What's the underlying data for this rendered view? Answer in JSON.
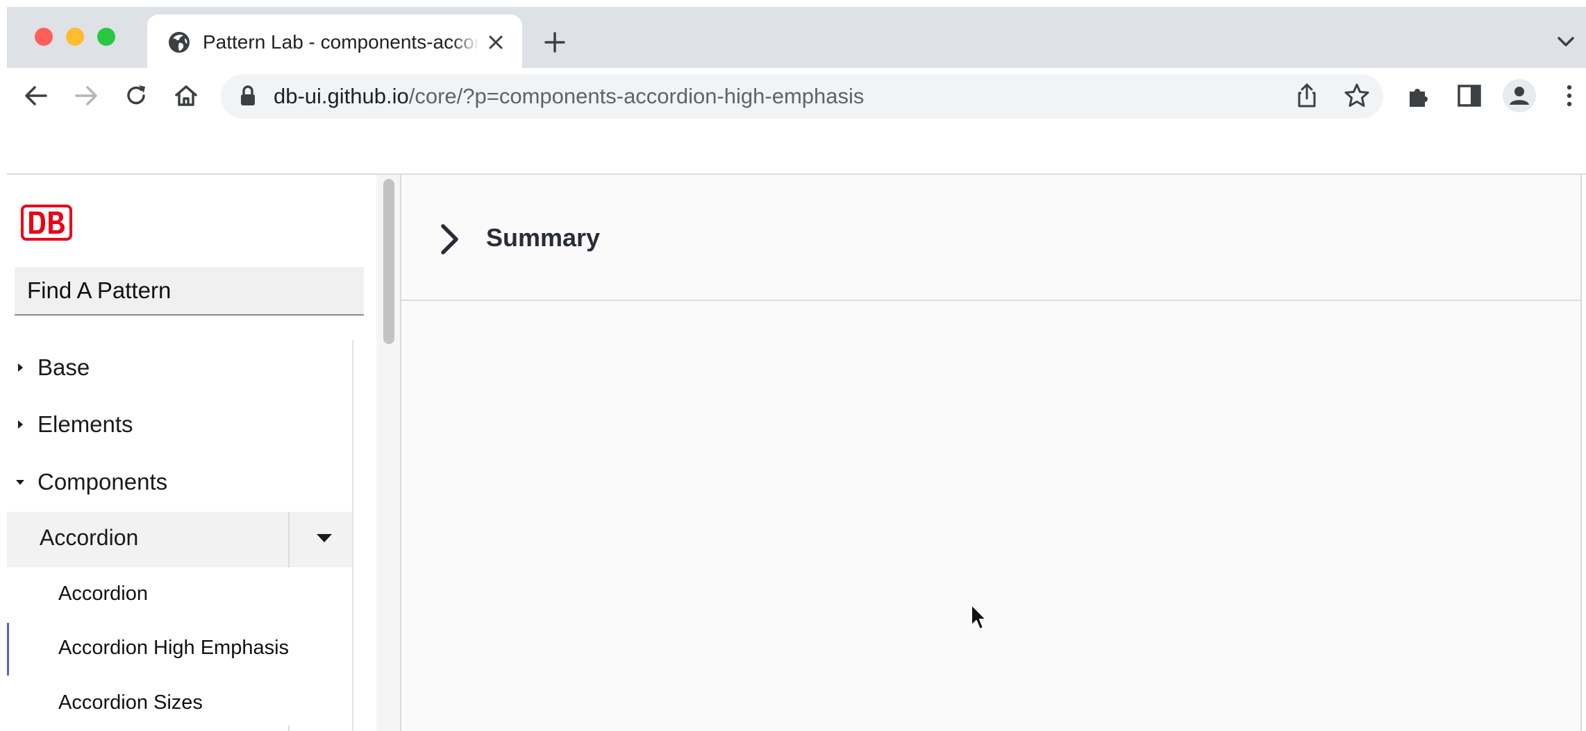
{
  "browser": {
    "tab": {
      "title": "Pattern Lab - components-accordion-high-emphasis",
      "icon": "globe-icon"
    },
    "url": {
      "host": "db-ui.github.io",
      "path": "/core/?p=components-accordion-high-emphasis"
    }
  },
  "sidebar": {
    "logo_text": "DB",
    "search": {
      "placeholder": "Find A Pattern"
    },
    "categories": [
      {
        "label": "Base",
        "expanded": false
      },
      {
        "label": "Elements",
        "expanded": false
      },
      {
        "label": "Components",
        "expanded": true
      }
    ],
    "group": {
      "label": "Accordion",
      "items": [
        {
          "label": "Accordion"
        },
        {
          "label": "Accordion High Emphasis",
          "active": true
        },
        {
          "label": "Accordion Sizes"
        }
      ]
    }
  },
  "main": {
    "summary_label": "Summary"
  },
  "colors": {
    "brand_red": "#ec0016",
    "active_indicator": "#5b5fc7",
    "tabbar": "#dee1e6"
  }
}
